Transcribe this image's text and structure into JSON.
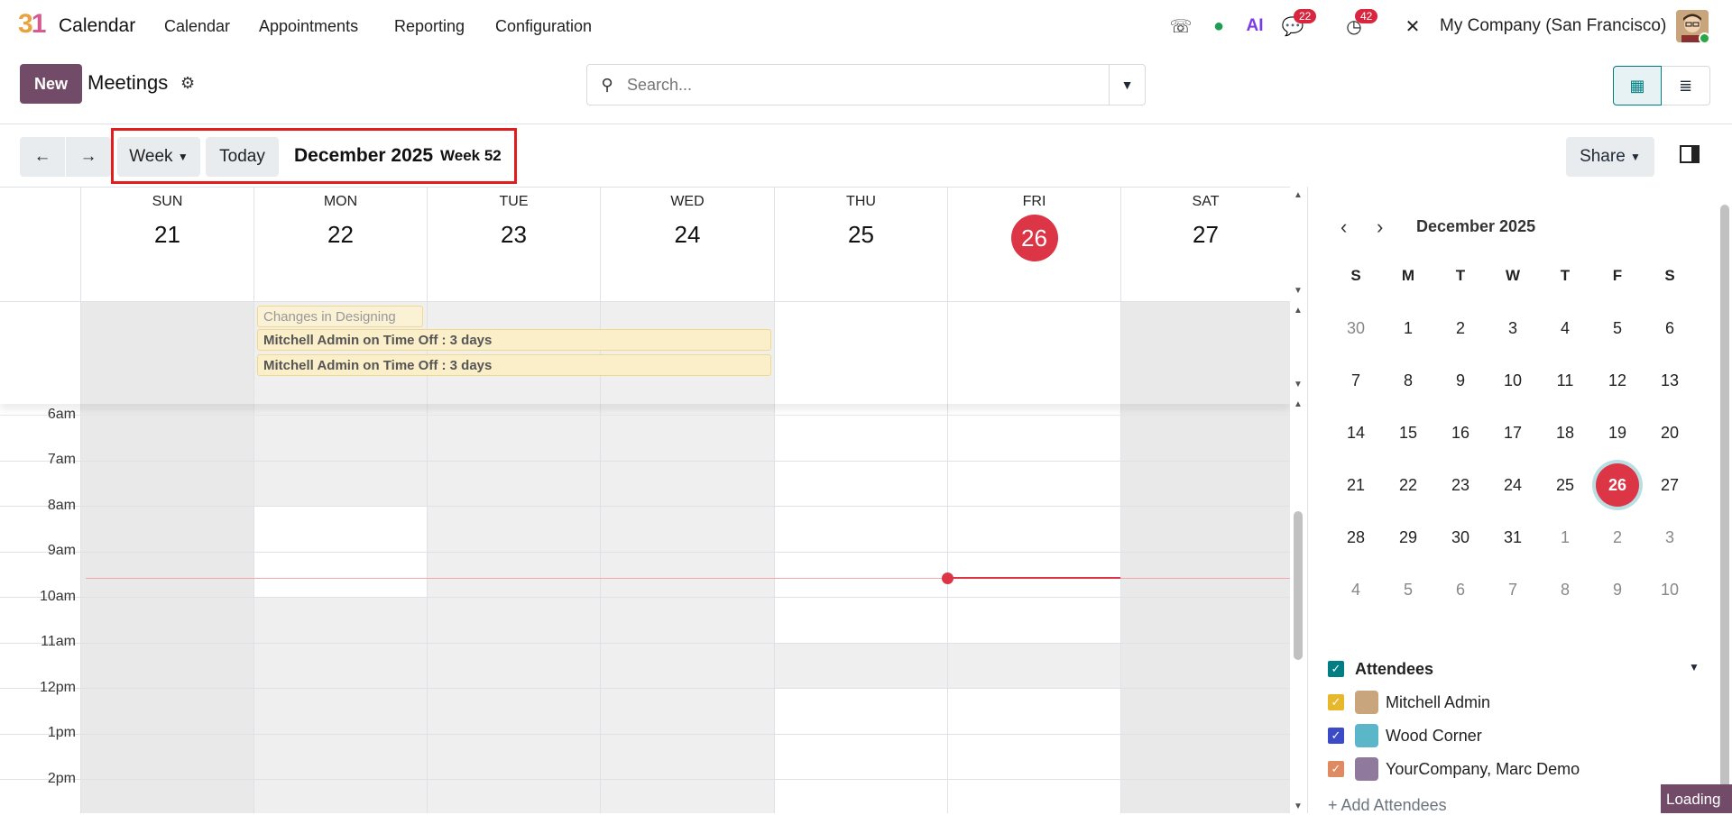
{
  "app": {
    "logo_a": "3",
    "logo_b": "1",
    "name": "Calendar"
  },
  "menu": [
    "Calendar",
    "Appointments",
    "Reporting",
    "Configuration"
  ],
  "systray": {
    "chat_count": "22",
    "activity_count": "42",
    "company": "My Company (San Francisco)"
  },
  "control_panel": {
    "new_label": "New",
    "breadcrumb": "Meetings",
    "search_placeholder": "Search..."
  },
  "toolbar": {
    "scale": "Week",
    "today": "Today",
    "period": "December 2025",
    "week": "Week 52",
    "share": "Share"
  },
  "week": {
    "days": [
      {
        "dow": "SUN",
        "num": "21"
      },
      {
        "dow": "MON",
        "num": "22"
      },
      {
        "dow": "TUE",
        "num": "23"
      },
      {
        "dow": "WED",
        "num": "24"
      },
      {
        "dow": "THU",
        "num": "25"
      },
      {
        "dow": "FRI",
        "num": "26"
      },
      {
        "dow": "SAT",
        "num": "27"
      }
    ],
    "events": [
      "Changes in Designing",
      "Mitchell Admin on Time Off : 3 days",
      "Mitchell Admin on Time Off : 3 days"
    ],
    "hours": [
      "6am",
      "7am",
      "8am",
      "9am",
      "10am",
      "11am",
      "12pm",
      "1pm",
      "2pm"
    ]
  },
  "mini_calendar": {
    "title": "December 2025",
    "weekday_heads": [
      "S",
      "M",
      "T",
      "W",
      "T",
      "F",
      "S"
    ],
    "weeks": [
      [
        "30",
        "1",
        "2",
        "3",
        "4",
        "5",
        "6"
      ],
      [
        "7",
        "8",
        "9",
        "10",
        "11",
        "12",
        "13"
      ],
      [
        "14",
        "15",
        "16",
        "17",
        "18",
        "19",
        "20"
      ],
      [
        "21",
        "22",
        "23",
        "24",
        "25",
        "26",
        "27"
      ],
      [
        "28",
        "29",
        "30",
        "31",
        "1",
        "2",
        "3"
      ],
      [
        "4",
        "5",
        "6",
        "7",
        "8",
        "9",
        "10"
      ]
    ],
    "selected": "26"
  },
  "filters": {
    "title": "Attendees",
    "items": [
      "Mitchell Admin",
      "Wood Corner",
      "YourCompany, Marc Demo"
    ],
    "add_label": "+ Add Attendees"
  },
  "status": {
    "loading": "Loading"
  },
  "colors": {
    "brand": "#714b67",
    "today": "#dc3545",
    "accent": "#017e84"
  }
}
